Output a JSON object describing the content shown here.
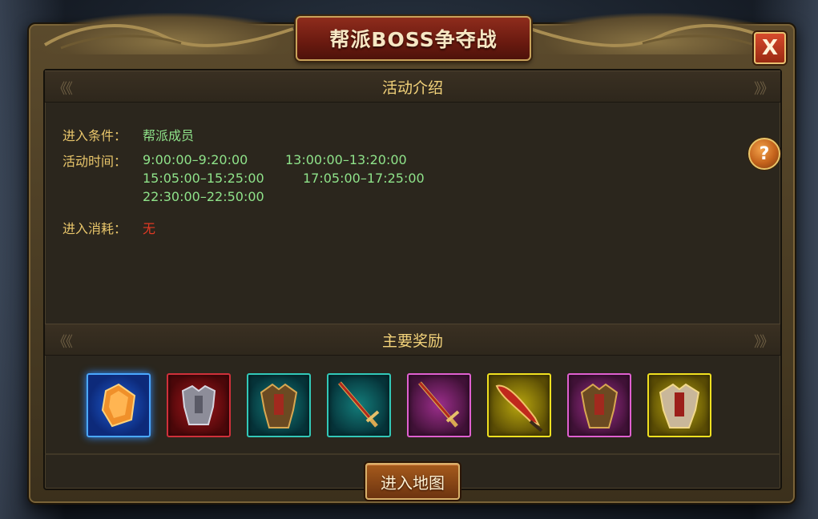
{
  "dialog": {
    "title": "帮派BOSS争夺战",
    "close_label": "X"
  },
  "intro": {
    "header": "活动介绍",
    "entry_condition_label": "进入条件：",
    "entry_condition_value": "帮派成员",
    "activity_time_label": "活动时间：",
    "times": [
      [
        "9:00:00–9:20:00",
        "13:00:00–13:20:00"
      ],
      [
        "15:05:00–15:25:00",
        "17:05:00–17:25:00"
      ],
      [
        "22:30:00–22:50:00"
      ]
    ],
    "entry_cost_label": "进入消耗：",
    "entry_cost_value": "无",
    "help_label": "?"
  },
  "rewards": {
    "header": "主要奖励",
    "items": [
      {
        "name": "gem",
        "frame": "blue"
      },
      {
        "name": "armor",
        "frame": "red"
      },
      {
        "name": "armor",
        "frame": "teal"
      },
      {
        "name": "sword",
        "frame": "teal"
      },
      {
        "name": "sword",
        "frame": "pink"
      },
      {
        "name": "blade",
        "frame": "gold"
      },
      {
        "name": "armor",
        "frame": "pink"
      },
      {
        "name": "armor",
        "frame": "gold"
      }
    ]
  },
  "enter_button": "进入地图"
}
